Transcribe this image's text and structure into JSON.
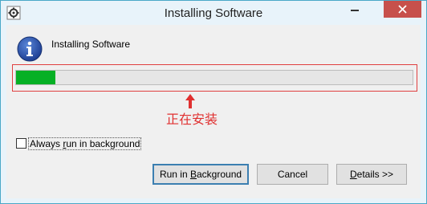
{
  "window": {
    "title": "Installing Software",
    "icon": "gear-icon"
  },
  "dialog": {
    "heading": "Installing Software",
    "info_icon": "info-icon",
    "progress": 0.1,
    "progress_color": "#06b025",
    "annotation": "正在安装",
    "annotation_color": "#e03030"
  },
  "options": {
    "always_background_label_parts": [
      "Always ",
      "r",
      "un in background"
    ],
    "always_background_checked": false
  },
  "buttons": {
    "run_background_parts": [
      "Run in ",
      "B",
      "ackground"
    ],
    "cancel": "Cancel",
    "details_parts": [
      "",
      "D",
      "etails >>"
    ]
  },
  "colors": {
    "close_button": "#c7504b",
    "window_border": "#4aa8c8"
  }
}
